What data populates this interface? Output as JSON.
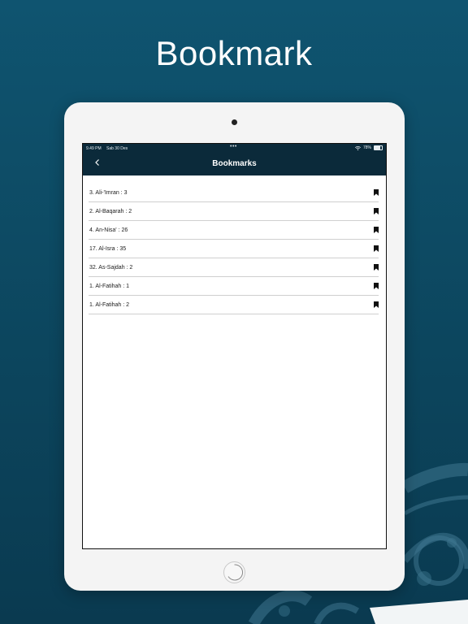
{
  "page": {
    "headline": "Bookmark"
  },
  "status_bar": {
    "time": "9.49 PM",
    "date": "Sab 30 Des",
    "wifi_icon": "wifi-icon",
    "battery_text": "78%",
    "battery_level": 0.78
  },
  "nav": {
    "title": "Bookmarks",
    "back_icon": "chevron-left-icon"
  },
  "bookmarks": [
    {
      "label": "3. Ali-'Imran : 3",
      "icon": "bookmark-icon"
    },
    {
      "label": "2. Al-Baqarah : 2",
      "icon": "bookmark-icon"
    },
    {
      "label": "4. An-Nisa' : 26",
      "icon": "bookmark-icon"
    },
    {
      "label": "17. Al-Isra : 35",
      "icon": "bookmark-icon"
    },
    {
      "label": "32. As-Sajdah : 2",
      "icon": "bookmark-icon"
    },
    {
      "label": "1. Al-Fatihah : 1",
      "icon": "bookmark-icon"
    },
    {
      "label": "1. Al-Fatihah : 2",
      "icon": "bookmark-icon"
    }
  ],
  "colors": {
    "background": "#0d4a63",
    "header": "#0b2a3a",
    "tablet_frame": "#f4f4f4",
    "divider": "#cfcfcf"
  }
}
